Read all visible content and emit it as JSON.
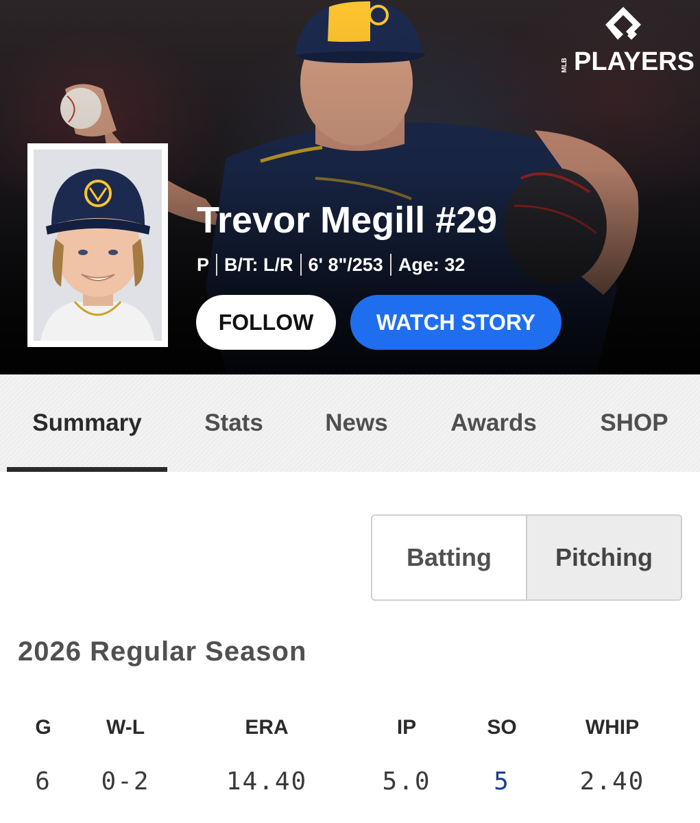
{
  "brand": {
    "wordmark": "PLAYERS",
    "league": "MLB"
  },
  "player": {
    "name_line": "Trevor Megill #29",
    "position": "P",
    "bats_throws": "B/T: L/R",
    "height_weight": "6' 8\"/253",
    "age": "Age: 32"
  },
  "actions": {
    "follow_label": "FOLLOW",
    "watch_label": "WATCH STORY"
  },
  "tabs": [
    {
      "label": "Summary",
      "active": true
    },
    {
      "label": "Stats",
      "active": false
    },
    {
      "label": "News",
      "active": false
    },
    {
      "label": "Awards",
      "active": false
    },
    {
      "label": "SHOP",
      "active": false
    }
  ],
  "stat_toggle": {
    "options": [
      "Batting",
      "Pitching"
    ],
    "selected": "Pitching"
  },
  "season": {
    "title": "2026 Regular Season",
    "headers": [
      "G",
      "W-L",
      "ERA",
      "IP",
      "SO",
      "WHIP"
    ],
    "values": [
      "6",
      "0-2",
      "14.40",
      "5.0",
      "5",
      "2.40"
    ]
  },
  "colors": {
    "accent_blue": "#1f6ef0",
    "link_blue": "#1c3d8f",
    "brewers_navy": "#1b2a4e",
    "brewers_gold": "#ffc52f"
  }
}
